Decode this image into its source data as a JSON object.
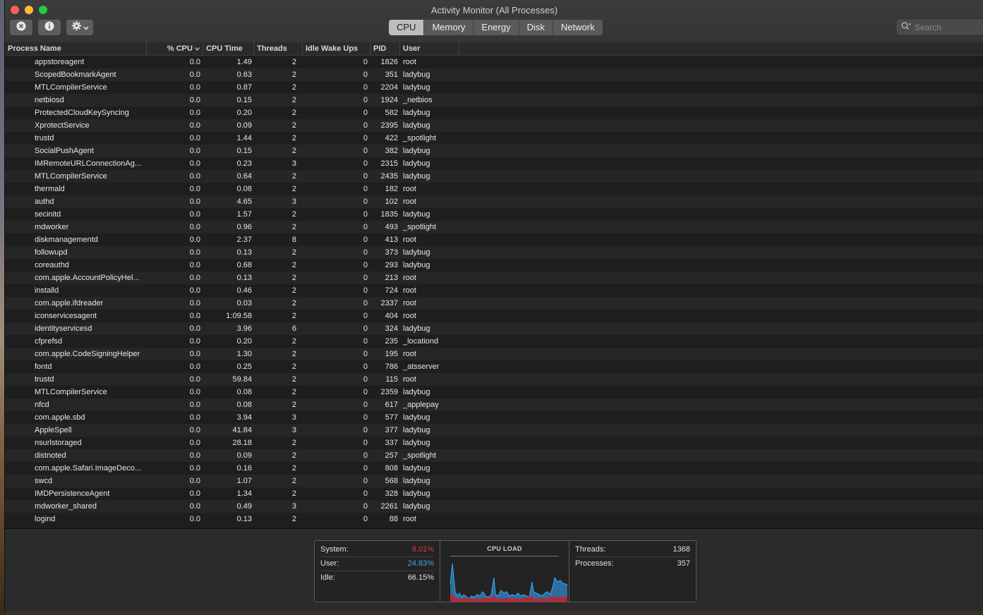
{
  "window": {
    "title": "Activity Monitor (All Processes)"
  },
  "toolbar": {
    "tabs": [
      {
        "label": "CPU",
        "active": true
      },
      {
        "label": "Memory",
        "active": false
      },
      {
        "label": "Energy",
        "active": false
      },
      {
        "label": "Disk",
        "active": false
      },
      {
        "label": "Network",
        "active": false
      }
    ],
    "search_placeholder": "Search",
    "icons": [
      "stop-process-icon",
      "info-icon",
      "gear-icon",
      "chevron-down-icon",
      "search-icon"
    ]
  },
  "table": {
    "columns": [
      "Process Name",
      "% CPU",
      "CPU Time",
      "Threads",
      "Idle Wake Ups",
      "PID",
      "User"
    ],
    "sort_column": "% CPU",
    "rows": [
      [
        "appstoreagent",
        "0.0",
        "1.49",
        "2",
        "0",
        "1826",
        "root"
      ],
      [
        "ScopedBookmarkAgent",
        "0.0",
        "0.63",
        "2",
        "0",
        "351",
        "ladybug"
      ],
      [
        "MTLCompilerService",
        "0.0",
        "0.87",
        "2",
        "0",
        "2204",
        "ladybug"
      ],
      [
        "netbiosd",
        "0.0",
        "0.15",
        "2",
        "0",
        "1924",
        "_netbios"
      ],
      [
        "ProtectedCloudKeySyncing",
        "0.0",
        "0.20",
        "2",
        "0",
        "582",
        "ladybug"
      ],
      [
        "XprotectService",
        "0.0",
        "0.09",
        "2",
        "0",
        "2395",
        "ladybug"
      ],
      [
        "trustd",
        "0.0",
        "1.44",
        "2",
        "0",
        "422",
        "_spotlight"
      ],
      [
        "SocialPushAgent",
        "0.0",
        "0.15",
        "2",
        "0",
        "382",
        "ladybug"
      ],
      [
        "IMRemoteURLConnectionAg...",
        "0.0",
        "0.23",
        "3",
        "0",
        "2315",
        "ladybug"
      ],
      [
        "MTLCompilerService",
        "0.0",
        "0.64",
        "2",
        "0",
        "2435",
        "ladybug"
      ],
      [
        "thermald",
        "0.0",
        "0.08",
        "2",
        "0",
        "182",
        "root"
      ],
      [
        "authd",
        "0.0",
        "4.65",
        "3",
        "0",
        "102",
        "root"
      ],
      [
        "secinitd",
        "0.0",
        "1.57",
        "2",
        "0",
        "1835",
        "ladybug"
      ],
      [
        "mdworker",
        "0.0",
        "0.96",
        "2",
        "0",
        "493",
        "_spotlight"
      ],
      [
        "diskmanagementd",
        "0.0",
        "2.37",
        "8",
        "0",
        "413",
        "root"
      ],
      [
        "followupd",
        "0.0",
        "0.13",
        "2",
        "0",
        "373",
        "ladybug"
      ],
      [
        "coreauthd",
        "0.0",
        "0.68",
        "2",
        "0",
        "293",
        "ladybug"
      ],
      [
        "com.apple.AccountPolicyHel...",
        "0.0",
        "0.13",
        "2",
        "0",
        "213",
        "root"
      ],
      [
        "installd",
        "0.0",
        "0.46",
        "2",
        "0",
        "724",
        "root"
      ],
      [
        "com.apple.ifdreader",
        "0.0",
        "0.03",
        "2",
        "0",
        "2337",
        "root"
      ],
      [
        "iconservicesagent",
        "0.0",
        "1:09.58",
        "2",
        "0",
        "404",
        "root"
      ],
      [
        "identityservicesd",
        "0.0",
        "3.96",
        "6",
        "0",
        "324",
        "ladybug"
      ],
      [
        "cfprefsd",
        "0.0",
        "0.20",
        "2",
        "0",
        "235",
        "_locationd"
      ],
      [
        "com.apple.CodeSigningHelper",
        "0.0",
        "1.30",
        "2",
        "0",
        "195",
        "root"
      ],
      [
        "fontd",
        "0.0",
        "0.25",
        "2",
        "0",
        "786",
        "_atsserver"
      ],
      [
        "trustd",
        "0.0",
        "59.84",
        "2",
        "0",
        "115",
        "root"
      ],
      [
        "MTLCompilerService",
        "0.0",
        "0.08",
        "2",
        "0",
        "2359",
        "ladybug"
      ],
      [
        "nfcd",
        "0.0",
        "0.08",
        "2",
        "0",
        "617",
        "_applepay"
      ],
      [
        "com.apple.sbd",
        "0.0",
        "3.94",
        "3",
        "0",
        "577",
        "ladybug"
      ],
      [
        "AppleSpell",
        "0.0",
        "41.84",
        "3",
        "0",
        "377",
        "ladybug"
      ],
      [
        "nsurlstoraged",
        "0.0",
        "28.18",
        "2",
        "0",
        "337",
        "ladybug"
      ],
      [
        "distnoted",
        "0.0",
        "0.09",
        "2",
        "0",
        "257",
        "_spotlight"
      ],
      [
        "com.apple.Safari.ImageDeco...",
        "0.0",
        "0.16",
        "2",
        "0",
        "808",
        "ladybug"
      ],
      [
        "swcd",
        "0.0",
        "1.07",
        "2",
        "0",
        "568",
        "ladybug"
      ],
      [
        "IMDPersistenceAgent",
        "0.0",
        "1.34",
        "2",
        "0",
        "328",
        "ladybug"
      ],
      [
        "mdworker_shared",
        "0.0",
        "0.49",
        "3",
        "0",
        "2261",
        "ladybug"
      ],
      [
        "logind",
        "0.0",
        "0.13",
        "2",
        "0",
        "88",
        "root"
      ]
    ]
  },
  "summary": {
    "system_label": "System:",
    "system_value": "9.01%",
    "user_label": "User:",
    "user_value": "24.83%",
    "idle_label": "Idle:",
    "idle_value": "66.15%",
    "cpu_load_title": "CPU LOAD",
    "threads_label": "Threads:",
    "threads_value": "1368",
    "processes_label": "Processes:",
    "processes_value": "357",
    "colors": {
      "system": "#e0383e",
      "user": "#3ba7e8"
    }
  }
}
